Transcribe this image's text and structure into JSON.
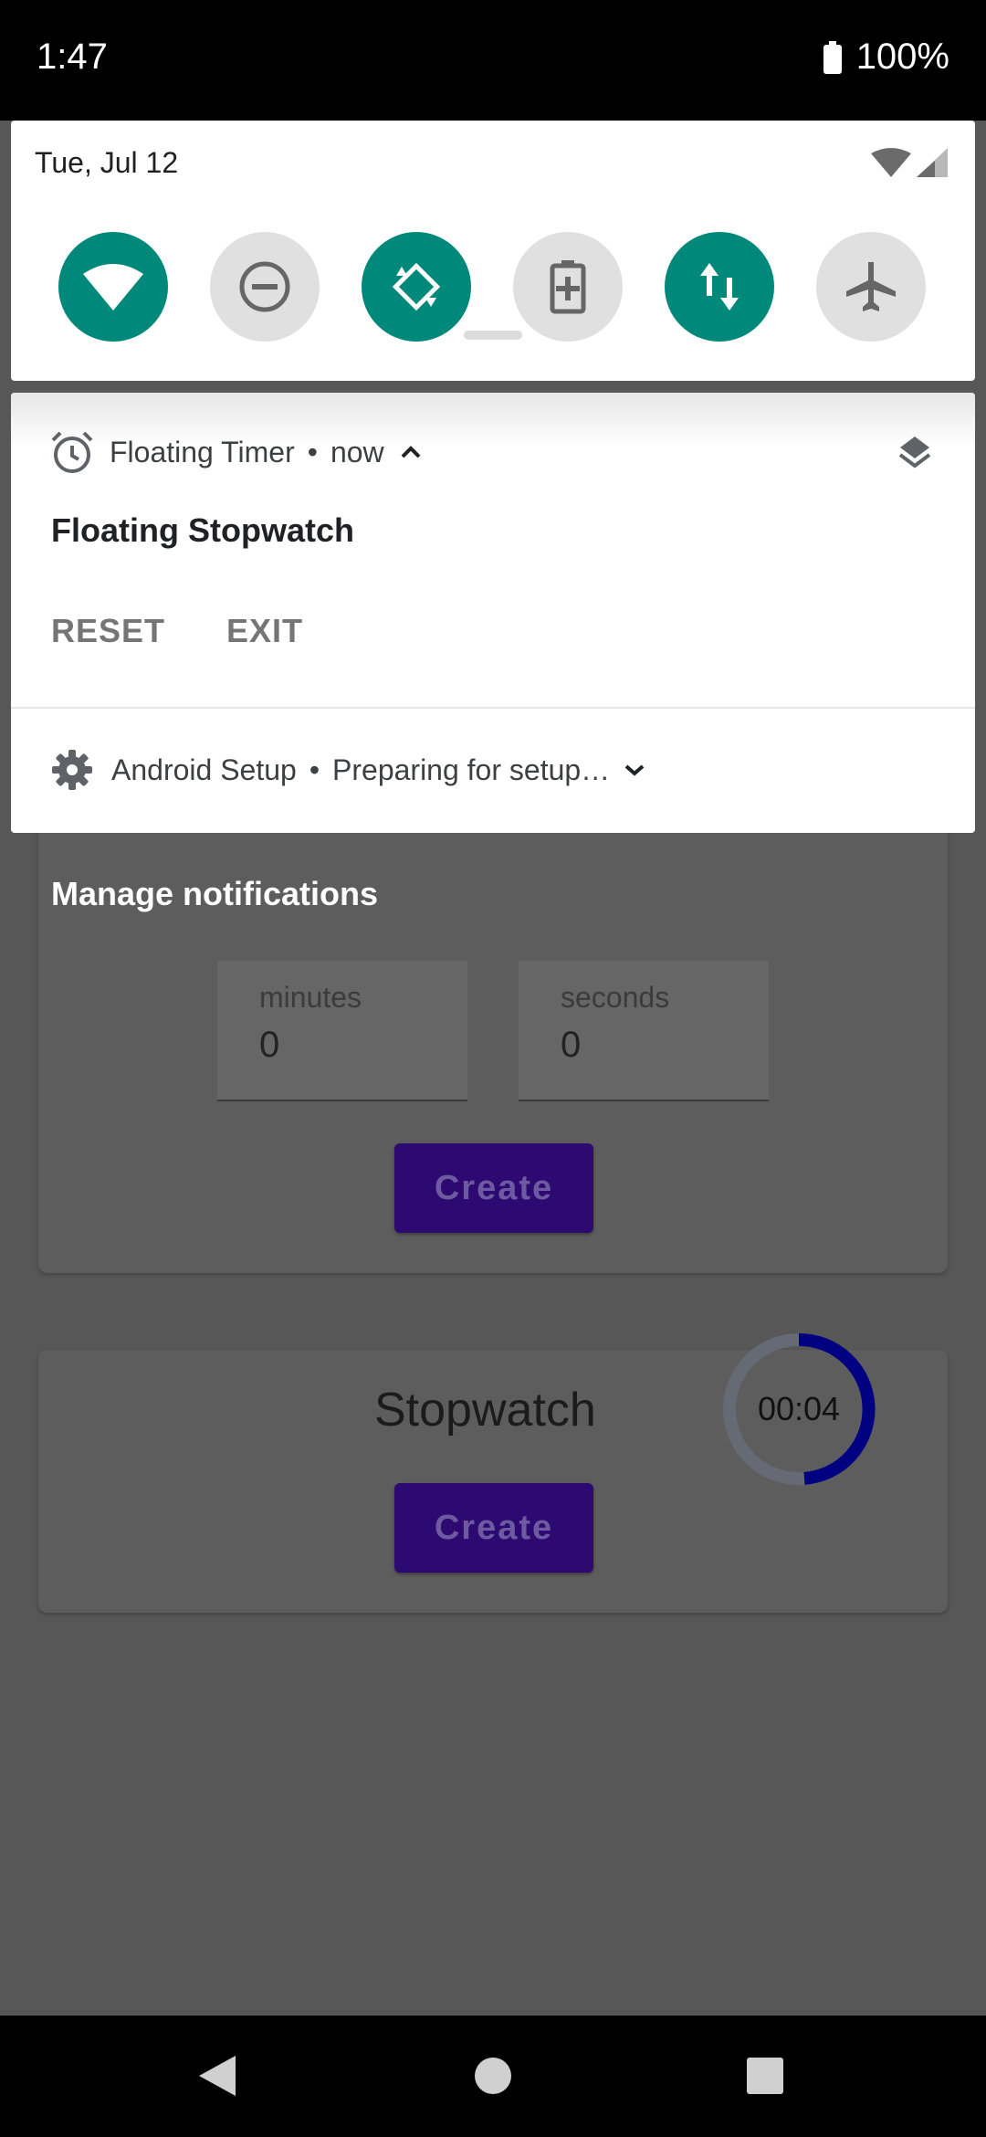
{
  "status_bar": {
    "time": "1:47",
    "battery": "100%"
  },
  "quick_settings": {
    "date": "Tue, Jul 12",
    "tiles": [
      {
        "name": "wifi-tile",
        "icon": "wifi-icon",
        "state": "on"
      },
      {
        "name": "dnd-tile",
        "icon": "do-not-disturb-icon",
        "state": "off"
      },
      {
        "name": "auto-rotate-tile",
        "icon": "auto-rotate-icon",
        "state": "on"
      },
      {
        "name": "battery-saver-tile",
        "icon": "battery-saver-icon",
        "state": "off"
      },
      {
        "name": "mobile-data-tile",
        "icon": "data-transfer-icon",
        "state": "on"
      },
      {
        "name": "airplane-mode-tile",
        "icon": "airplane-icon",
        "state": "off"
      }
    ],
    "accent": "#00897b"
  },
  "notifications": {
    "timer": {
      "app": "Floating Timer",
      "time": "now",
      "title": "Floating Stopwatch",
      "actions": {
        "reset": "RESET",
        "exit": "EXIT"
      }
    },
    "setup": {
      "app": "Android Setup",
      "text": "Preparing for setup…"
    },
    "manage_label": "Manage notifications"
  },
  "background_app": {
    "timer_card": {
      "minutes_label": "minutes",
      "minutes_value": "0",
      "seconds_label": "seconds",
      "seconds_value": "0",
      "create_label": "Create"
    },
    "stopwatch_card": {
      "title": "Stopwatch",
      "elapsed": "00:04",
      "create_label": "Create"
    }
  }
}
